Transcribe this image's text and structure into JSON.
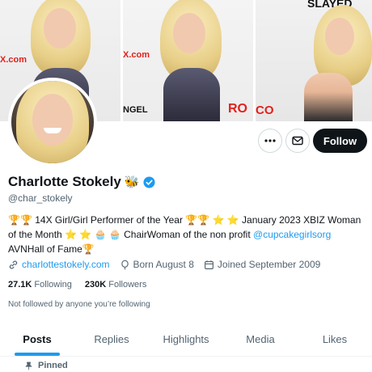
{
  "banner": {
    "watermarks": [
      "X.com",
      "X.com",
      "SLAYED",
      "NGEL",
      "RO",
      "CO"
    ]
  },
  "profile": {
    "name": "Charlotte Stokely",
    "name_emoji": "🐝",
    "handle": "@char_stokely",
    "bio_prefix": "🏆🏆 14X Girl/Girl Performer of the Year 🏆🏆 ⭐ ⭐ January 2023 XBIZ Woman of the Month ⭐ ⭐ 🧁 🧁 ChairWoman of the non profit ",
    "bio_link": "@cupcakegirlsorg",
    "bio_suffix": " AVNHall of Fame🏆",
    "website": "charlottestokely.com",
    "birthday": "Born August 8",
    "joined": "Joined September 2009",
    "following_count": "27.1K",
    "following_label": "Following",
    "followers_count": "230K",
    "followers_label": "Followers",
    "not_followed": "Not followed by anyone you’re following"
  },
  "actions": {
    "more_icon": "more-icon",
    "message_icon": "mail-icon",
    "follow_label": "Follow"
  },
  "tabs": [
    {
      "label": "Posts",
      "active": true
    },
    {
      "label": "Replies",
      "active": false
    },
    {
      "label": "Highlights",
      "active": false
    },
    {
      "label": "Media",
      "active": false
    },
    {
      "label": "Likes",
      "active": false
    }
  ],
  "feed": {
    "pinned_label": "Pinned"
  },
  "colors": {
    "accent": "#1d9bf0",
    "text": "#0f1419",
    "muted": "#536471",
    "follow_bg": "#0f1419"
  }
}
